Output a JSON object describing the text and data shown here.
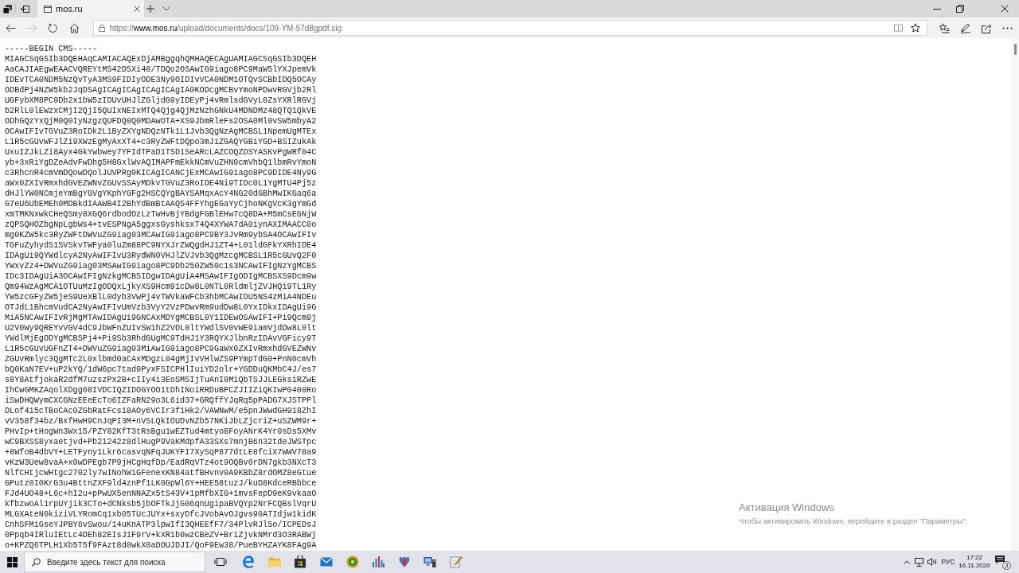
{
  "tab_bar": {
    "tabs": [
      {
        "title": "mos.ru",
        "selected": true
      }
    ]
  },
  "toolbar": {
    "nav_buttons": [
      {
        "kind": "back",
        "disabled": false
      },
      {
        "kind": "forward",
        "disabled": true
      },
      {
        "kind": "refresh",
        "disabled": false
      },
      {
        "kind": "home",
        "disabled": false
      }
    ],
    "address": "https://**www.mos.ru**/upload/documents/docs/109-YM-57d8gpdf.sig"
  },
  "page": {
    "lines": [
      "-----BEGIN CMS-----",
      "MIAGCSqGSIb3DQEHAqCAMIACAQExDjAMBggqhQMHAQECAgUAMIAGCSqGSIb3DQEH",
      "AaCAJIAEgwEAACVQREYtMS42DSXi48/TDQo2OSAwIG9iago8PC9MaW5lYXJpemVk",
      "IDEvTCA0NDM5NzQvTyA3MS9FIDIyODE3Ny9OIDIvVCA0NDM1OTQvSCBbIDQ5OCAy",
      "ODBdPj4NZW5kb2JqDSAgICAgICAgICAgICAgIA0KODcgMCBvYmoNPDwvRGVjb2Rl",
      "UGFybXM8PC9Db2x1bW5zIDUvUHJlZGljdG9yIDEyPj4vRmlsdGVyL0ZsYXRlRGVj",
      "b2RlL0lEWzxCMjI2QjI5QUIxNEIxMTQ4Qjg4QjMzNzhGNkU4MDNDMz48QTQ1QkVE",
      "ODhGQzYxQjM0Q0IyNzgzQUFDQ0Q0MDAwOTA+XS9JbmRleFs2OSA0Ml0vSW5mbyA2",
      "OCAwIFIvTGVuZ3RoIDk2L1ByZXYgNDQzNTk1L1Jvb3QgNzAgMCBSL1NpemUgMTEx",
      "L1R5cGUvWFJlZi9XWzEgMyAxXT4+c3RyZWFtDQpo3mJiZGAQYGBiYGD+BSIZukAk",
      "UxuIZJkLZi8Ayx4GkYwbwey7YFIdTPaD1TSD1SeARcLAZCOQZDSYASKvPgWRf04C",
      "yb+3xRiYgDZeAdvFwDhg5H8GxlWvAQIMAPFmEkkNCmVuZHN0cmVhbQ1lbmRvYmoN",
      "c3RhcnR4cmVmDQowDQolJUVPRg0KICAgICANCjExMCAwIG9iago8PC9DIDE4Ny9G",
      "aWx0ZXIvRmxhdGVEZWNvZGUvSSAyMDkvTGVuZ3RoIDE4Ni9TIDc0L1YgMTU4Pj5z",
      "dHJlYW0NCmjeYmBgYGVgYKphYGFg2HSCQYgBAYSAMqxAcY4NG20dGBhMwIKGaq6a",
      "G7eU6UbEMEh0MDBkdIAAWB4I2BhYdBmBtAAQS4FFYhgEGaYyCjhoNKgVcK3gYmGd",
      "xmTMKNxwkCHeQSmy8XGQ6rdbodOzLzTwHvBjYBdgFGBlEHw7cQ8DA+M5mCsEGNjW",
      "zQPSQHOZbgNpLgbWs4+tvESPNgA5ggxsGyshksxT4Q4XYWA7dA0iynAXIMAACC0o",
      "mg0KZW5kc3RyZWFtDWVuZG9iag03MCAwIG9iago8PC9BY3JvRm9ybSA4OCAwIFIv",
      "TGFuZyhydS1SVSkvTWFya0luZm88PC9NYXJrZWQgdHJ1ZT4+L01ldGFkYXRhIDE4",
      "IDAgUi9QYWdlcyA2NyAwIFIvU3RydWN0VHJlZVJvb3QgMzcgMCBSL1R5cGUvQ2F0",
      "YWxvZz4+DWVuZG9iag03MSAwIG9iago8PC9Db250ZW50c1s3NCAwIFIgNzYgMCBS",
      "IDc3IDAgUiA3OCAwIFIgNzkgMCBSIDgwIDAgUiA4MSAwIFIgODIgMCBSXS9Dcm9w",
      "Qm94WzAgMCA1OTUuMzIgODQxLjkyXS9Hcm91cDw8L0NTL0RldmljZVJHQi9TL1Ry",
      "YW5zcGFyZW5jeS9UeXBlL0dyb3VwPj4vTWVkaWFCb3hbMCAwIDU5NS4zMiA4NDEu",
      "OTJdL1BhcmVudCA2NyAwIFIvUmVzb3VyY2VzPDwvRm9udDw8L0YxIDkxIDAgUi9G",
      "MiA5NCAwIFIvRjMgMTAwIDAgUi9GNCAxMDYgMCBSL0Y1IDEwOSAwIFI+Pi9Qcm9j",
      "U2V0Wy9QREYvVGV4dC9JbWFnZUIvSW1hZ2VDL0ltYWdlSV0vWE9iamVjdDw8L0lt",
      "YWdlMjEgODYgMCBSPj4+Pi9Sb3RhdGUgMC9TdHJ1Y3RQYXJlbnRzIDAvVGFicy9T",
      "L1R5cGUvUGFnZT4+DWVuZG9iag03MiAwIG9iago8PC9GaWx0ZXIvRmxhdGVEZWNv",
      "ZGUvRmlyc3QgMTc2L0xlbmd0aCAxMDgzL04gMjIvVHlwZS9PYmpTdG0+PnN0cmVh",
      "bQ0KaN7EV+uP2kYQ/1dW6pc7tad9PyxFSICPHlIuiYD2olr+YGDDuQKMbC4J/es7",
      "s8Y8AtfjokaR2dfM7uzszPx2B+cIIy4i3EoSMSIjTuAnI0MiQbTSJJLEGksiRZwE",
      "IhCwGMKZAqolXDgg08IVDCIQZIDOGYOO1tDhINoiRRDuBPCZJIIZiQKIwP0400Ro",
      "iSwDHQWymCXCGNzEEeEcTo6IZFaRN29o3L6id37+GRQffYJqRq5pPADG7XJSTPPl",
      "DLof415cTBoCAc0ZGbRatFcs18AOy6VCIr3f1Hk2/VAWNwM/e5pnJWwdGH918ZhI",
      "vV358f34bz/BxfHwH9CnJqPI3M+nVSLQkIOUDvNZb57NKiJbLZjcriZ+uSZWM9r+",
      "PHvIp+tHogWn3Wx15/PZY82KfT3tRsBgu1wEZTud4mtyo8FoyANrK4Yr0sDs5XMv",
      "wC9BXSS8yxaetjvd+Pb21242z8dlHugP9VaKMdpfA33SXs7mnjB6n32tdeJWSTpc",
      "+8WfoB4dbVY+LETFyny1Lkr6casvqNFqJUKYFI7XySqP877dtLE8fciX7WWV78a9",
      "vKzW3Uew8vaA+x0wDPEgb7P9jHCgHqfDp/EadRqVTz4ot9OQBv0rDN7gkb3NXcT3",
      "NlfCHtjcWHtgc2702ly7wINohWiGFenexKN84atfBHvnv0A9KBbZ8rdOMZ8eGtue",
      "GPutz0I0KrG3u4BttnZXF9ld4znPf1LK0GpWl6Y+HEE58tuzJ/kuD8KdceRBbbce",
      "FJd4UO48+L6c+hI2u+pPwUX5enNNAZx5tS43V+1pMfbXIG+1mvsFepD9eK9vkaaO",
      "kfbzwoAl1rpUYjik3CTo+dCNksb5jbOFTkJjG06qnUgipaBVQYp2NrFCQBslVqrU",
      "MLGXAteN0kiziVLYRomCq1xb05TUcJUYx+sxyDfcJVobAvOJgvs90ATIdjw1kidK",
      "CnhSFMiGseYJPBY6vSwou/14uKnATP3lpwIfI3QHEEfF7/34PlvRJl5o/ICPEDsJ",
      "0Ppqb4IRluIEtLc4DEh82EIsJ1F9rV+kXR1b0wzCBeZV+BriZjvkNMrd3O3RABWj",
      "o+KPZQ6TPLH1Xb5T5f9FAzt8d0wkX0aDOUJDJI/QoF9Ew38/PueBYHZAYK8FAg9A"
    ]
  },
  "activation_notice": {
    "title": "Активация Windows",
    "text": "Чтобы активировать Windows, перейдите в раздел \"Параметры\"."
  },
  "taskbar": {
    "search": {
      "placeholder": "Введите здесь текст для поиска"
    },
    "apps": [
      {
        "kind": "taskview"
      },
      {
        "kind": "edge"
      },
      {
        "kind": "folder"
      },
      {
        "kind": "store"
      },
      {
        "kind": "mail"
      },
      {
        "kind": "badge"
      },
      {
        "kind": "chart"
      },
      {
        "kind": "emblem"
      },
      {
        "kind": "computer"
      },
      {
        "kind": "pencil"
      }
    ],
    "tray": {
      "language": "РУС",
      "time": "17:22",
      "date": "16.11.2020",
      "notifications": "3"
    }
  }
}
